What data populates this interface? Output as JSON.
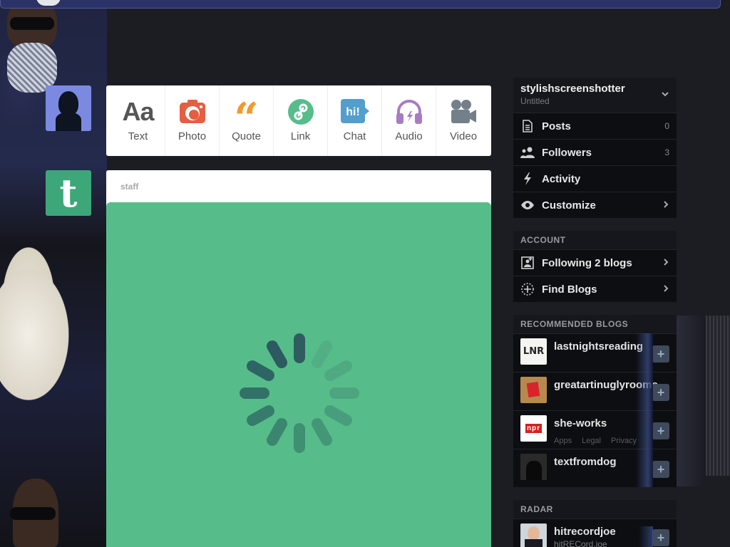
{
  "post_types": [
    {
      "label": "Text",
      "icon": "text-icon",
      "color": "#555555"
    },
    {
      "label": "Photo",
      "icon": "camera-icon",
      "color": "#e65e42"
    },
    {
      "label": "Quote",
      "icon": "quote-icon",
      "color": "#f2992e"
    },
    {
      "label": "Link",
      "icon": "link-icon",
      "color": "#56bc8a"
    },
    {
      "label": "Chat",
      "icon": "chat-icon",
      "color": "#529ecc"
    },
    {
      "label": "Audio",
      "icon": "headphones-icon",
      "color": "#a77dc2"
    },
    {
      "label": "Video",
      "icon": "video-camera-icon",
      "color": "#748089"
    }
  ],
  "post": {
    "author": "staff",
    "media_color": "#56bd8a"
  },
  "sidebar": {
    "blog_name": "stylishscreenshotter",
    "blog_title": "Untitled",
    "menu": [
      {
        "label": "Posts",
        "count": "0",
        "icon": "document-icon"
      },
      {
        "label": "Followers",
        "count": "3",
        "icon": "people-icon"
      },
      {
        "label": "Activity",
        "count": "",
        "icon": "lightning-icon"
      },
      {
        "label": "Customize",
        "count": "",
        "icon": "eye-icon"
      }
    ],
    "account_header": "ACCOUNT",
    "account": [
      {
        "label": "Following 2 blogs",
        "icon": "add-person-icon"
      },
      {
        "label": "Find Blogs",
        "icon": "compass-icon"
      }
    ],
    "recommended_header": "RECOMMENDED BLOGS",
    "recommended": [
      {
        "name": "lastnightsreading",
        "avatar_text": "LNR"
      },
      {
        "name": "greatartinuglyrooms",
        "avatar_text": ""
      },
      {
        "name": "she-works",
        "avatar_text": "npr"
      },
      {
        "name": "textfromdog",
        "avatar_text": ""
      }
    ],
    "footer_links": [
      "Apps",
      "Legal",
      "Privacy"
    ],
    "radar_header": "RADAR",
    "radar": {
      "name": "hitrecordjoe",
      "subtitle": "hitRECord.joe"
    }
  },
  "accent": "#56bd8a"
}
